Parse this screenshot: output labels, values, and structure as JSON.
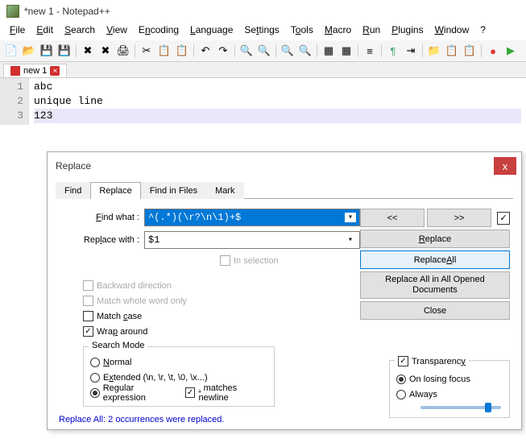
{
  "title": "*new 1 - Notepad++",
  "menu": {
    "file": "File",
    "edit": "Edit",
    "search": "Search",
    "view": "View",
    "encoding": "Encoding",
    "language": "Language",
    "settings": "Settings",
    "tools": "Tools",
    "macro": "Macro",
    "run": "Run",
    "plugins": "Plugins",
    "window": "Window",
    "help": "?"
  },
  "tab": {
    "name": "new 1",
    "close": "×"
  },
  "editor": {
    "lines": [
      "abc",
      "unique line",
      "123"
    ],
    "lineNumbers": [
      "1",
      "2",
      "3"
    ]
  },
  "dialog": {
    "title": "Replace",
    "close": "x",
    "tabs": {
      "find": "Find",
      "replace": "Replace",
      "findinfiles": "Find in Files",
      "mark": "Mark"
    },
    "labels": {
      "findwhat": "Find what :",
      "replacewith": "Replace with :",
      "inselection": "In selection",
      "backward": "Backward direction",
      "matchwhole": "Match whole word only",
      "matchcase": "Match case",
      "wrap": "Wrap around",
      "searchmode": "Search Mode",
      "normal": "Normal",
      "extended": "Extended (\\n, \\r, \\t, \\0, \\x...)",
      "regex": "Regular expression",
      "matchesnewline": ". matches newline",
      "transparency": "Transparency",
      "onlosing": "On losing focus",
      "always": "Always"
    },
    "values": {
      "findwhat": "^(.*)(\\r?\\n\\1)+$",
      "replacewith": "$1"
    },
    "buttons": {
      "prev": "<<",
      "next": ">>",
      "replace": "Replace",
      "replaceall": "Replace All",
      "replaceallopen": "Replace All in All Opened Documents",
      "close": "Close"
    },
    "status": "Replace All: 2 occurrences were replaced."
  }
}
